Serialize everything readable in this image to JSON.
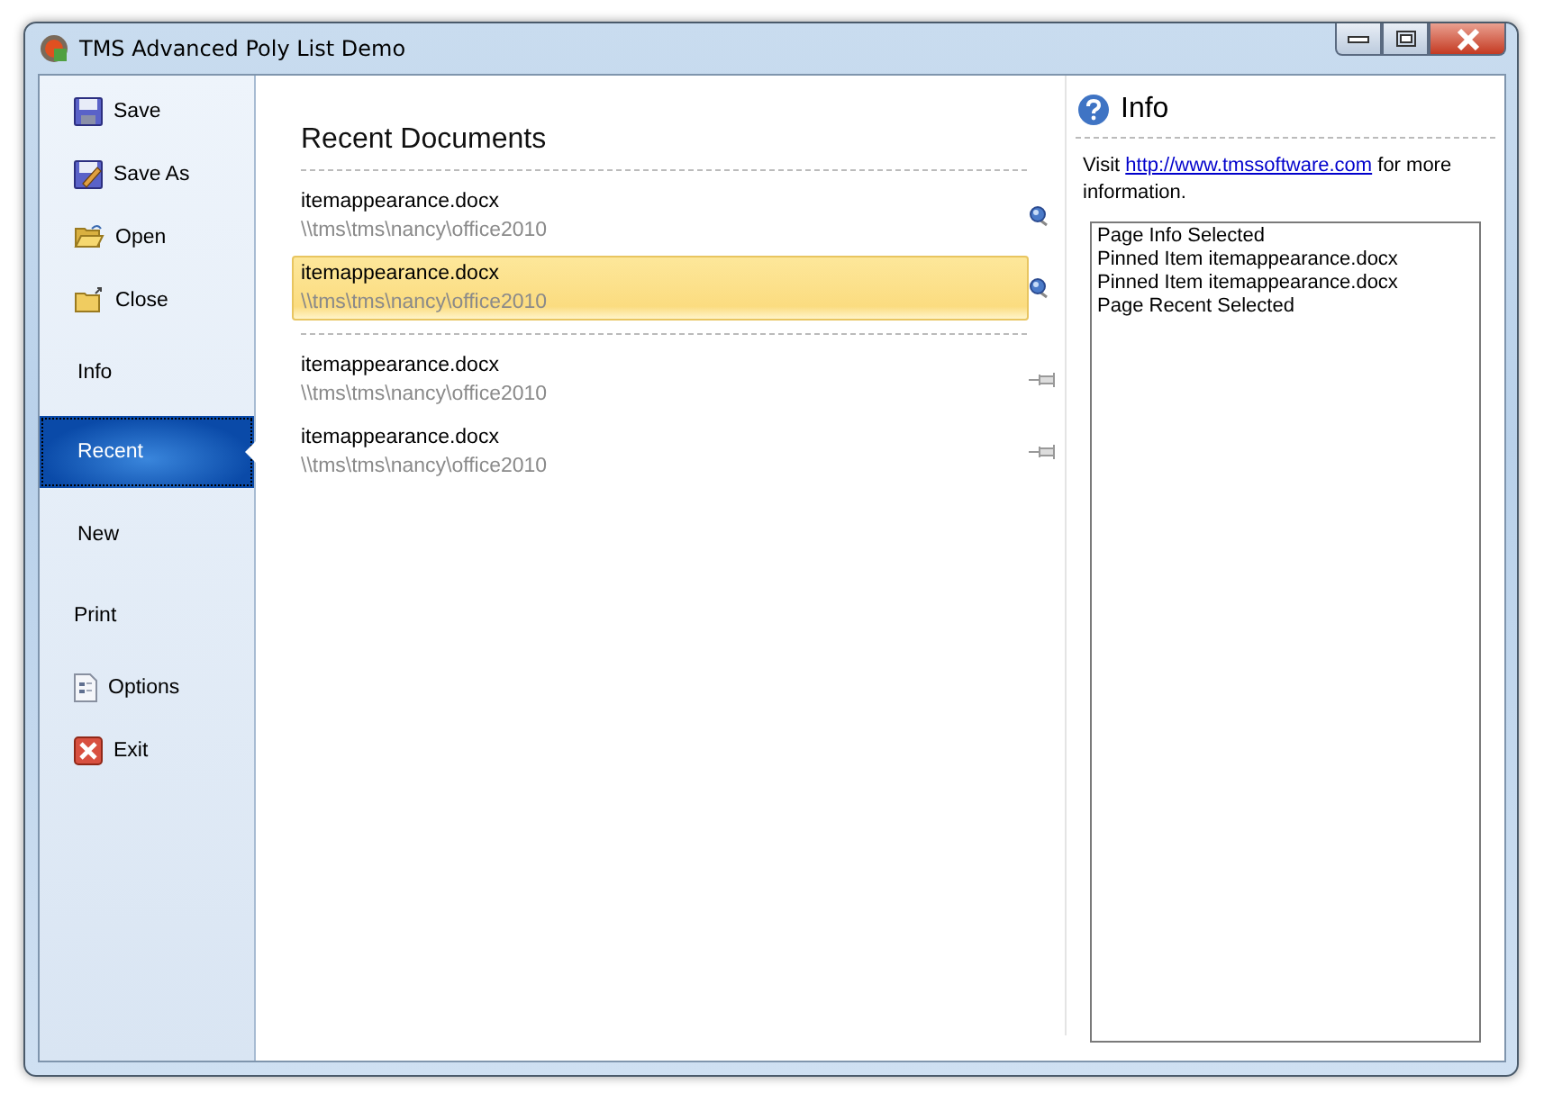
{
  "window": {
    "title": "TMS Advanced Poly List Demo"
  },
  "sidebar": {
    "items": [
      {
        "label": "Save",
        "kind": "command",
        "selected": false
      },
      {
        "label": "Save As",
        "kind": "command",
        "selected": false
      },
      {
        "label": "Open",
        "kind": "command",
        "selected": false
      },
      {
        "label": "Close",
        "kind": "command",
        "selected": false
      },
      {
        "label": "Info",
        "kind": "page",
        "selected": false
      },
      {
        "label": "Recent",
        "kind": "page",
        "selected": true
      },
      {
        "label": "New",
        "kind": "page",
        "selected": false
      },
      {
        "label": "Print",
        "kind": "page",
        "selected": false
      },
      {
        "label": "Options",
        "kind": "command",
        "selected": false
      },
      {
        "label": "Exit",
        "kind": "command",
        "selected": false
      }
    ]
  },
  "recent": {
    "heading": "Recent Documents",
    "groups": [
      {
        "items": [
          {
            "name": "itemappearance.docx",
            "path": "\\\\tms\\tms\\nancy\\office2010",
            "pinned": true,
            "selected": false
          },
          {
            "name": "itemappearance.docx",
            "path": "\\\\tms\\tms\\nancy\\office2010",
            "pinned": true,
            "selected": true
          }
        ]
      },
      {
        "items": [
          {
            "name": "itemappearance.docx",
            "path": "\\\\tms\\tms\\nancy\\office2010",
            "pinned": false,
            "selected": false
          },
          {
            "name": "itemappearance.docx",
            "path": "\\\\tms\\tms\\nancy\\office2010",
            "pinned": false,
            "selected": false
          }
        ]
      }
    ]
  },
  "info": {
    "title": "Info",
    "text_before": "Visit",
    "link": "http://www.tmssoftware.com",
    "text_after": "for more information.",
    "log": [
      "Page Info Selected",
      "Pinned Item itemappearance.docx",
      "Pinned Item itemappearance.docx",
      "Page Recent Selected"
    ]
  }
}
